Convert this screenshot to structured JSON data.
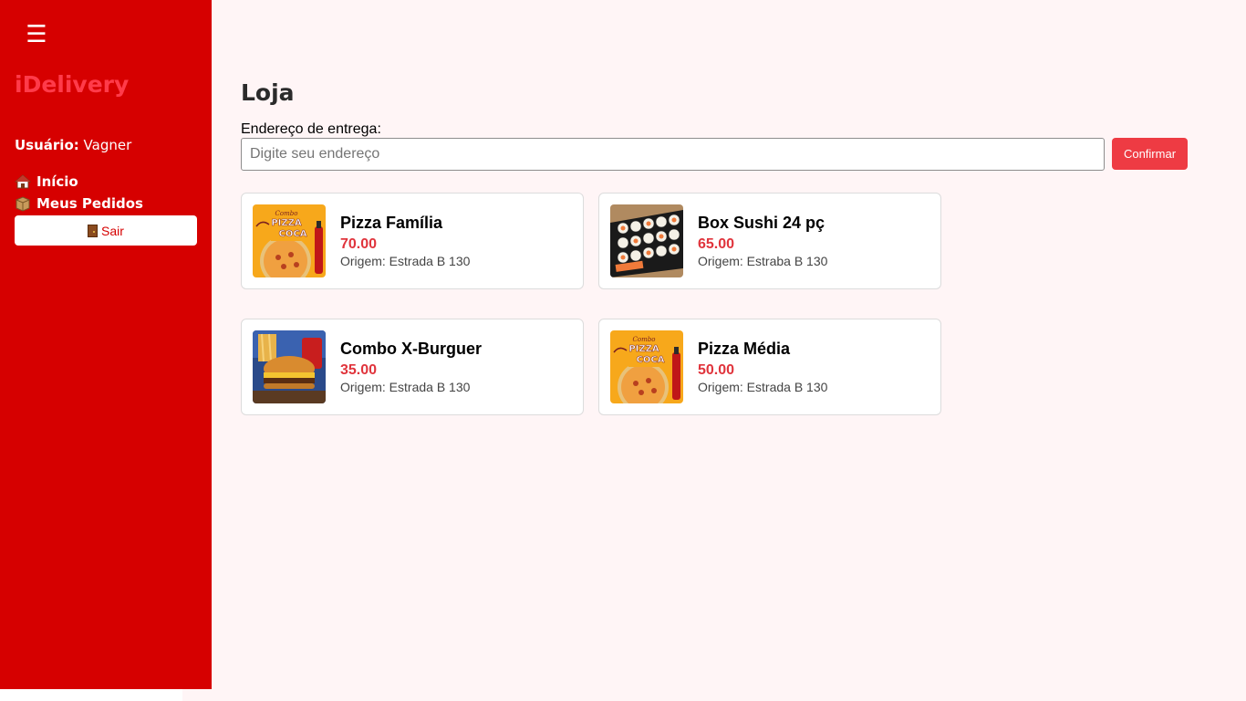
{
  "sidebar": {
    "menu_icon": "☰",
    "brand": "iDelivery",
    "user_label": "Usuário:",
    "user_name": "Vagner",
    "nav": [
      {
        "label": "Início",
        "icon": "house-icon"
      },
      {
        "label": "Meus Pedidos",
        "icon": "package-icon"
      }
    ],
    "logout_label": "Sair",
    "logout_icon": "door-icon",
    "color": "#d60000",
    "brand_color": "#ff3b4a"
  },
  "main": {
    "title": "Loja",
    "address_label": "Endereço de entrega:",
    "address_placeholder": "Digite seu endereço",
    "address_value": "",
    "confirm_label": "Confirmar",
    "accent_color": "#ee3b43"
  },
  "products": [
    {
      "name": "Pizza Família",
      "price": "70.00",
      "origin": "Origem: Estrada B 130",
      "image": "pizza-coca-combo"
    },
    {
      "name": "Box Sushi 24 pç",
      "price": "65.00",
      "origin": "Origem: Estraba B 130",
      "image": "sushi-box"
    },
    {
      "name": "Combo X-Burguer",
      "price": "35.00",
      "origin": "Origem: Estrada B 130",
      "image": "burger-combo"
    },
    {
      "name": "Pizza Média",
      "price": "50.00",
      "origin": "Origem: Estrada B 130",
      "image": "pizza-coca-combo"
    }
  ]
}
